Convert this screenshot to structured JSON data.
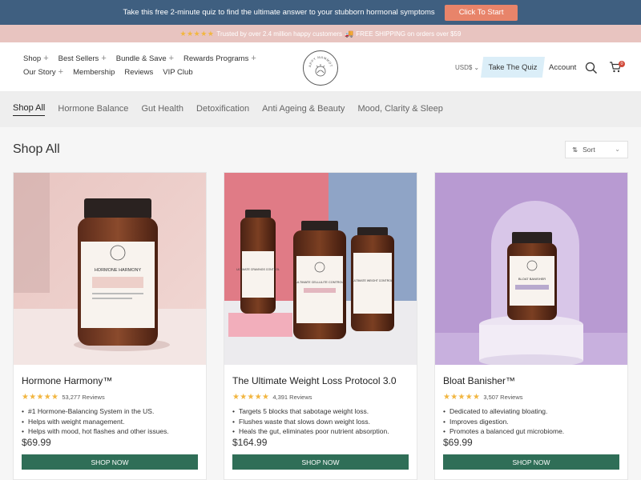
{
  "promo": {
    "text": "Take this free 2-minute quiz to find the ultimate answer to your stubborn hormonal symptoms",
    "button": "Click To Start",
    "colors": {
      "bar": "#3f5f80",
      "button": "#e8846a"
    }
  },
  "trust": {
    "stars": "★★★★★",
    "text": "Trusted by over 2.4 million happy customers",
    "shipping_icon": "🚚",
    "shipping": "FREE SHIPPING on orders over $59"
  },
  "nav": {
    "items": [
      {
        "label": "Shop",
        "expandable": true
      },
      {
        "label": "Best Sellers",
        "expandable": true
      },
      {
        "label": "Bundle & Save",
        "expandable": true
      },
      {
        "label": "Rewards Programs",
        "expandable": true
      },
      {
        "label": "Our Story",
        "expandable": true
      },
      {
        "label": "Membership",
        "expandable": false
      },
      {
        "label": "Reviews",
        "expandable": false
      },
      {
        "label": "VIP Club",
        "expandable": false
      }
    ],
    "logo_text": "HAPPY MAMMOTH",
    "currency": "USD$",
    "quiz": "Take The Quiz",
    "account": "Account",
    "cart_count": "0",
    "icons": {
      "search": "search-icon",
      "cart": "cart-icon"
    }
  },
  "filters": {
    "tabs": [
      "Shop All",
      "Hormone Balance",
      "Gut Health",
      "Detoxification",
      "Anti Ageing & Beauty",
      "Mood, Clarity & Sleep"
    ],
    "active": "Shop All"
  },
  "main": {
    "title": "Shop All",
    "sort_label": "Sort"
  },
  "products": [
    {
      "name": "Hormone Harmony™",
      "stars": "★★★★★",
      "reviews": "53,277 Reviews",
      "features": [
        "#1 Hormone-Balancing System in the US.",
        "Helps with weight management.",
        "Helps with mood, hot flashes and other issues."
      ],
      "price": "$69.99",
      "button": "SHOP NOW",
      "jar_labels": [
        "HORMONE HARMONY"
      ]
    },
    {
      "name": "The Ultimate Weight Loss Protocol 3.0",
      "stars": "★★★★★",
      "reviews": "4,391 Reviews",
      "features": [
        "Targets 5 blocks that sabotage weight loss.",
        "Flushes waste that slows down weight loss.",
        "Heals the gut, eliminates poor nutrient absorption."
      ],
      "price": "$164.99",
      "button": "SHOP NOW",
      "jar_labels": [
        "ULTIMATE CRAVINGS CONTROL",
        "ULTIMATE CELLULITE CONTROL",
        "ULTIMATE WEIGHT CONTROL"
      ]
    },
    {
      "name": "Bloat Banisher™",
      "stars": "★★★★★",
      "reviews": "3,507 Reviews",
      "features": [
        "Dedicated to alleviating bloating.",
        "Improves digestion.",
        "Promotes a balanced gut microbiome."
      ],
      "price": "$69.99",
      "button": "SHOP NOW",
      "jar_labels": [
        "BLOAT BANISHER"
      ]
    }
  ],
  "theme": {
    "button_green": "#2f6e57",
    "star_gold": "#f2b640",
    "quiz_blue": "#dbeef8"
  }
}
